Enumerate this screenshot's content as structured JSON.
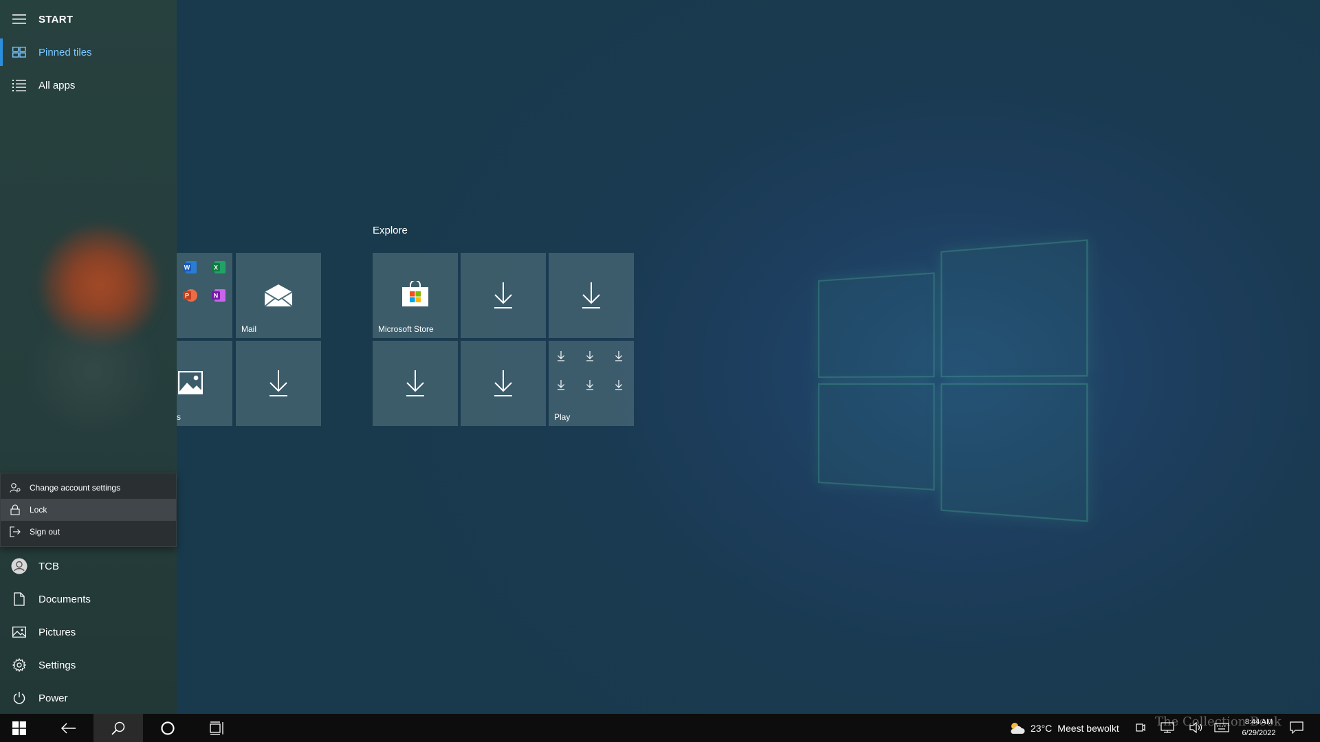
{
  "sidebar": {
    "title": "START",
    "nav": [
      {
        "label": "Pinned tiles",
        "icon": "tiles-icon",
        "active": true
      },
      {
        "label": "All apps",
        "icon": "list-icon",
        "active": false
      }
    ],
    "account_menu": [
      {
        "label": "Change account settings",
        "icon": "account-settings-icon"
      },
      {
        "label": "Lock",
        "icon": "lock-icon"
      },
      {
        "label": "Sign out",
        "icon": "sign-out-icon"
      }
    ],
    "bottom": [
      {
        "label": "TCB",
        "icon": "user-avatar-icon"
      },
      {
        "label": "Documents",
        "icon": "document-icon"
      },
      {
        "label": "Pictures",
        "icon": "pictures-icon"
      },
      {
        "label": "Settings",
        "icon": "gear-icon"
      },
      {
        "label": "Power",
        "icon": "power-icon"
      }
    ]
  },
  "tiles": {
    "group_label": "Explore",
    "labels": {
      "mail": "Mail",
      "photos_partial": "s",
      "store": "Microsoft Store",
      "play": "Play"
    }
  },
  "taskbar": {
    "weather_temp": "23°C",
    "weather_desc": "Meest bewolkt",
    "time": "8:44 AM",
    "date": "6/29/2022",
    "watermark": "The Collection Book"
  },
  "colors": {
    "accent": "#2b8fe0",
    "active_text": "#7cc6ff"
  }
}
